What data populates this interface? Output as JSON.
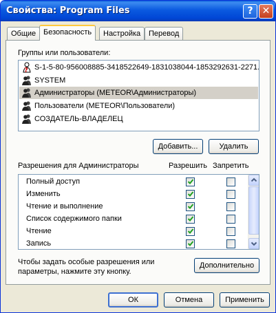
{
  "window": {
    "title": "Свойства: Program Files",
    "help_glyph": "?",
    "close_glyph": "✕"
  },
  "tabs": [
    {
      "label": "Общие",
      "active": false
    },
    {
      "label": "Безопасность",
      "active": true
    },
    {
      "label": "Настройка",
      "active": false
    },
    {
      "label": "Перевод",
      "active": false
    }
  ],
  "users_section": {
    "label": "Группы или пользователи:",
    "items": [
      {
        "label": "S-1-5-80-956008885-3418522649-1831038044-1853292631-2271...",
        "icon": "unknown-sid-icon",
        "selected": false
      },
      {
        "label": "SYSTEM",
        "icon": "user-group-icon",
        "selected": false
      },
      {
        "label": "Администраторы (METEOR\\Администраторы)",
        "icon": "user-group-icon",
        "selected": true
      },
      {
        "label": "Пользователи (METEOR\\Пользователи)",
        "icon": "user-group-icon",
        "selected": false
      },
      {
        "label": "СОЗДАТЕЛЬ-ВЛАДЕЛЕЦ",
        "icon": "user-group-icon",
        "selected": false
      }
    ],
    "add_button": "Добавить...",
    "remove_button": "Удалить"
  },
  "permissions": {
    "label": "Разрешения для Администраторы",
    "allow_header": "Разрешить",
    "deny_header": "Запретить",
    "rows": [
      {
        "name": "Полный доступ",
        "allow": true,
        "deny": false
      },
      {
        "name": "Изменить",
        "allow": true,
        "deny": false
      },
      {
        "name": "Чтение и выполнение",
        "allow": true,
        "deny": false
      },
      {
        "name": "Список содержимого папки",
        "allow": true,
        "deny": false
      },
      {
        "name": "Чтение",
        "allow": true,
        "deny": false
      },
      {
        "name": "Запись",
        "allow": true,
        "deny": false
      }
    ]
  },
  "advanced": {
    "hint_line1": "Чтобы задать особые разрешения или",
    "hint_line2": "параметры, нажмите эту кнопку.",
    "button": "Дополнительно"
  },
  "footer": {
    "ok": "ОК",
    "cancel": "Отмена",
    "apply": "Применить"
  },
  "colors": {
    "title_bar": "#0054e3",
    "dialog_bg": "#ece9d8",
    "check": "#21a121"
  }
}
